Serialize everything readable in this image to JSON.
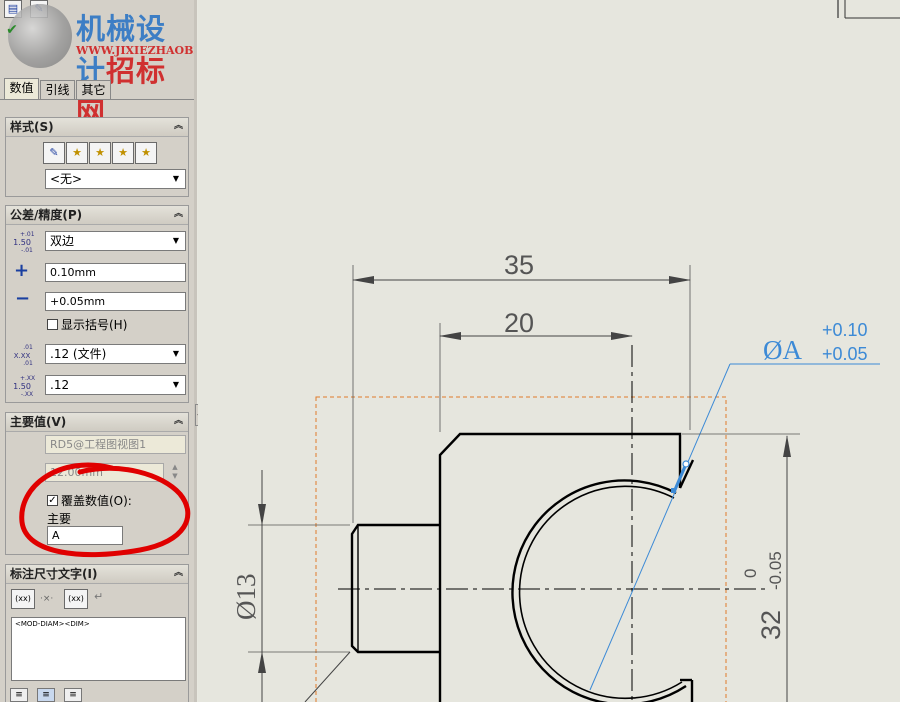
{
  "watermark": {
    "title_blue": "机械设计",
    "title_red": "招标网",
    "url": "WWW.JIXIEZHAOBIAO.COM"
  },
  "tabs": [
    {
      "label": "数值"
    },
    {
      "label": "引线"
    },
    {
      "label": "其它"
    }
  ],
  "style_group": {
    "title": "样式(S)",
    "dropdown_value": "<无>"
  },
  "tolerance_group": {
    "title": "公差/精度(P)",
    "type_value": "双边",
    "max_value": "0.10mm",
    "min_value": "+0.05mm",
    "show_parens_label": "显示括号(H)",
    "primary_precision": ".12 (文件)",
    "tolerance_precision": ".12",
    "icon_tol_text": "1.50",
    "icon_tol_sup": "+.01",
    "icon_tol_sub": "-.01",
    "icon_prec_text": "X.XX",
    "icon_prec_sup": ".01",
    "icon_prec_sub": ".01",
    "icon_tolprec_text": "1.50",
    "icon_tolprec_sup": "+.XX",
    "icon_tolprec_sub": "-.XX"
  },
  "primary_group": {
    "title": "主要值(V)",
    "reference": "RD5@工程图视图1",
    "value": "12.00mm",
    "override_label": "覆盖数值(O):",
    "primary_label": "主要",
    "override_value": "A"
  },
  "dimtext_group": {
    "title": "标注尺寸文字(I)",
    "btn_xx": "(xx)",
    "btn_xx2": "(xx)",
    "text": "<MOD-DIAM><DIM>"
  },
  "drawing": {
    "dim_35": "35",
    "dim_20": "20",
    "dim_phiA": "ØA",
    "tol_upper": "+0.10",
    "tol_lower": "+0.05",
    "dim_phi13": "Ø13",
    "dim_32": "32",
    "dim_32_upper": "0",
    "dim_32_lower": "-0.05"
  }
}
